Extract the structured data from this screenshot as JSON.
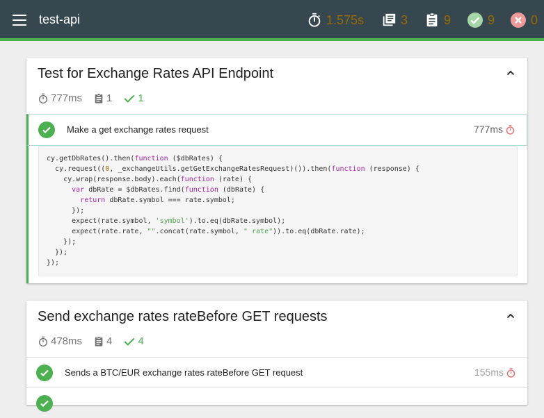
{
  "navbar": {
    "title": "test-api",
    "duration": "1.575s",
    "suites": "3",
    "tests": "9",
    "passes": "9",
    "failures": "0"
  },
  "suites": [
    {
      "title": "Test for Exchange Rates API Endpoint",
      "duration": "777ms",
      "tests": "1",
      "passes": "1",
      "tests_list": [
        {
          "title": "Make a get exchange rates request",
          "duration": "777ms",
          "state": "passed",
          "speed": "slow",
          "code": [
            [
              [
                "t",
                "cy.getDbRates().then("
              ],
              [
                "kw",
                "function"
              ],
              [
                "t",
                " ($dbRates) {"
              ]
            ],
            [
              [
                "t",
                "  cy.request(("
              ],
              [
                "num",
                "0"
              ],
              [
                "t",
                ", _exchangeUtils.getGetExchangeRatesRequest)()).then("
              ],
              [
                "kw",
                "function"
              ],
              [
                "t",
                " (response) {"
              ]
            ],
            [
              [
                "t",
                "    cy.wrap(response.body).each("
              ],
              [
                "kw",
                "function"
              ],
              [
                "t",
                " (rate) {"
              ]
            ],
            [
              [
                "t",
                "      "
              ],
              [
                "kw",
                "var"
              ],
              [
                "t",
                " dbRate = $dbRates.find("
              ],
              [
                "kw",
                "function"
              ],
              [
                "t",
                " (dbRate) {"
              ]
            ],
            [
              [
                "t",
                "        "
              ],
              [
                "kw",
                "return"
              ],
              [
                "t",
                " dbRate.symbol === rate.symbol;"
              ]
            ],
            [
              [
                "t",
                "      });"
              ]
            ],
            [
              [
                "t",
                "      expect(rate.symbol, "
              ],
              [
                "str",
                "'symbol'"
              ],
              [
                "t",
                ").to.eq(dbRate.symbol);"
              ]
            ],
            [
              [
                "t",
                "      expect(rate.rate, "
              ],
              [
                "str",
                "\"\""
              ],
              [
                "t",
                ".concat(rate.symbol, "
              ],
              [
                "str",
                "\" rate\""
              ],
              [
                "t",
                ")).to.eq(dbRate.rate);"
              ]
            ],
            [
              [
                "t",
                "    });"
              ]
            ],
            [
              [
                "t",
                "  });"
              ]
            ],
            [
              [
                "t",
                "});"
              ]
            ]
          ]
        }
      ]
    },
    {
      "title": "Send exchange rates rateBefore GET requests",
      "duration": "478ms",
      "tests": "4",
      "passes": "4",
      "tests_list": [
        {
          "title": "Sends a BTC/EUR exchange rates rateBefore GET request",
          "duration": "155ms",
          "state": "passed",
          "speed": "medium"
        }
      ]
    }
  ],
  "colors": {
    "navbar": "#37474f",
    "pass": "#4caf50",
    "fail": "#e57373",
    "timer_warn": "#e57373"
  },
  "icons": {
    "menu": "menu-icon",
    "timer": "stopwatch-icon",
    "suites": "library-books-icon",
    "tests": "clipboard-icon",
    "passes": "check-circle-icon",
    "failures": "cancel-circle-icon",
    "collapse": "chevron-up-icon",
    "check": "check-icon"
  }
}
